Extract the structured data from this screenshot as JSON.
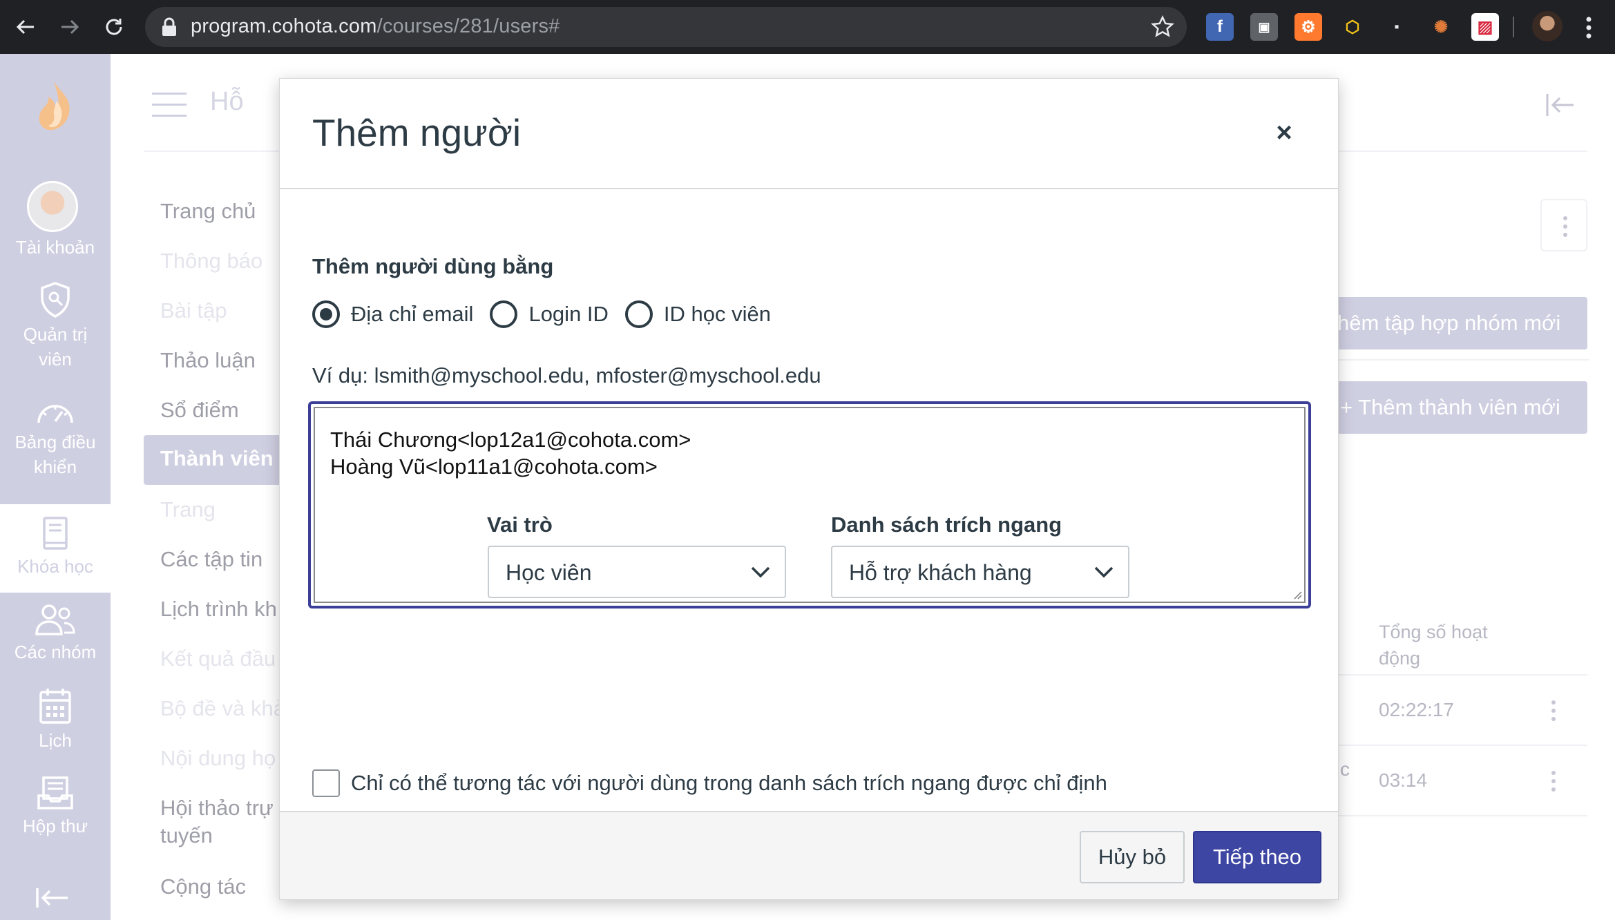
{
  "browser": {
    "url_host": "program.cohota.com",
    "url_path": "/courses/281/users#",
    "extensions": [
      "facebook-ext",
      "chat-ext",
      "hubspot-ext",
      "hex-ext",
      "meet-ext",
      "cookie-ext",
      "flag-ext"
    ]
  },
  "sidebar": {
    "items": [
      {
        "label": "Tài khoản",
        "icon": "avatar"
      },
      {
        "label": "Quản trị viên",
        "icon": "shield-icon"
      },
      {
        "label": "Bảng điều khiển",
        "icon": "dashboard-icon"
      },
      {
        "label": "Khóa học",
        "icon": "book-icon"
      },
      {
        "label": "Các nhóm",
        "icon": "groups-icon"
      },
      {
        "label": "Lịch",
        "icon": "calendar-icon"
      },
      {
        "label": "Hộp thư",
        "icon": "inbox-icon"
      }
    ]
  },
  "header": {
    "breadcrumb": "Hỗ"
  },
  "course_nav": [
    "Trang chủ",
    "Thông báo",
    "Bài tập",
    "Thảo luận",
    "Sổ điểm",
    "Thành viên",
    "Trang",
    "Các tập tin",
    "Lịch trình kh",
    "Kết quả đầu",
    "Bộ đề và khả",
    "Nội dung họ",
    "Hội thảo trự",
    "tuyến",
    "Cộng tác"
  ],
  "right_panel": {
    "btn_new_group_set": "hêm tập hợp nhóm mới",
    "btn_new_member": "Thêm thành viên mới",
    "plus": "+",
    "col_total_activity": "Tổng số hoạt động",
    "rows": [
      {
        "time": "02:22:17"
      },
      {
        "time": "03:14",
        "fragment": "c"
      }
    ]
  },
  "modal": {
    "title": "Thêm người",
    "close": "×",
    "add_by_label": "Thêm người dùng bằng",
    "radios": [
      {
        "label": "Địa chỉ email",
        "checked": true
      },
      {
        "label": "Login ID",
        "checked": false
      },
      {
        "label": "ID học viên",
        "checked": false
      }
    ],
    "example": "Ví dụ: lsmith@myschool.edu, mfoster@myschool.edu",
    "textarea_value": "Thái Chương<lop12a1@cohota.com>\nHoàng Vũ<lop11a1@cohota.com>",
    "role_label": "Vai trò",
    "role_value": "Học viên",
    "section_label": "Danh sách trích ngang",
    "section_value": "Hỗ trợ khách hàng",
    "restrict_label": "Chỉ có thể tương tác với người dùng trong danh sách trích ngang được chỉ định",
    "cancel": "Hủy bỏ",
    "next": "Tiếp theo"
  },
  "colors": {
    "accent": "#3d46a3",
    "sidebar": "#cfcfe2",
    "text": "#2d3b45"
  }
}
